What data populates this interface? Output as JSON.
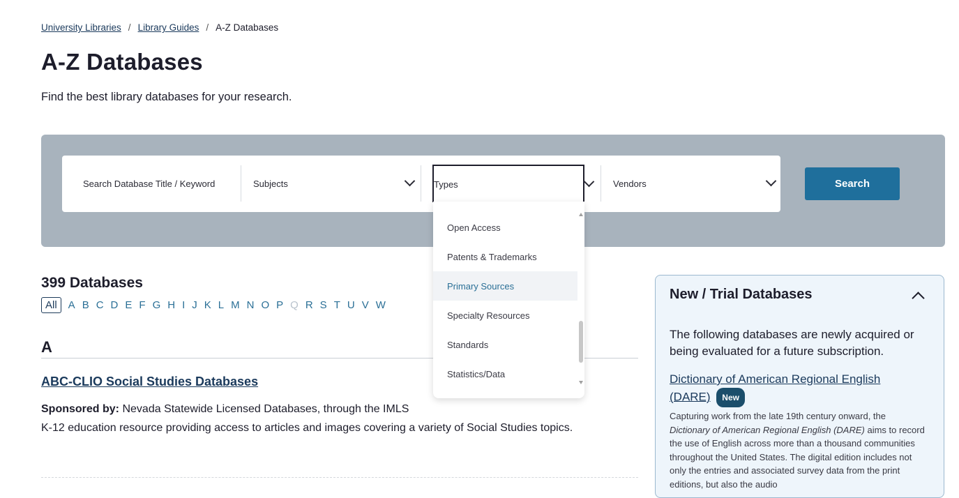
{
  "breadcrumb": {
    "items": [
      "University Libraries",
      "Library Guides"
    ],
    "current": "A-Z Databases",
    "separator": "/"
  },
  "page": {
    "title": "A-Z Databases",
    "subtitle": "Find the best library databases for your research."
  },
  "search": {
    "placeholder": "Search Database Title / Keyword",
    "subjects_label": "Subjects",
    "types_label": "Types",
    "vendors_label": "Vendors",
    "button_label": "Search"
  },
  "types_dropdown": {
    "items": [
      "Open Access",
      "Patents & Trademarks",
      "Primary Sources",
      "Specialty Resources",
      "Standards",
      "Statistics/Data"
    ],
    "highlighted": "Primary Sources"
  },
  "results": {
    "count_label": "399 Databases",
    "letters": [
      "All",
      "A",
      "B",
      "C",
      "D",
      "E",
      "F",
      "G",
      "H",
      "I",
      "J",
      "K",
      "L",
      "M",
      "N",
      "O",
      "P",
      "Q",
      "R",
      "S",
      "T",
      "U",
      "V",
      "W"
    ],
    "disabled_letters": [
      "Q"
    ]
  },
  "section": {
    "letter": "A",
    "databases": [
      {
        "title": "ABC-CLIO Social Studies Databases",
        "sponsor_label": "Sponsored by:",
        "sponsor": "Nevada Statewide Licensed Databases, through the IMLS",
        "description": "K-12 education resource providing access to articles and images covering a variety of Social Studies topics."
      }
    ]
  },
  "trial": {
    "heading": "New / Trial Databases",
    "intro": "The following databases are newly acquired or being evaluated for a future subscription.",
    "link_title": "Dictionary of American Regional English (DARE)",
    "badge": "New",
    "desc_before": "Capturing work from the late 19th century onward, the ",
    "desc_italic": "Dictionary of American Regional English (DARE)",
    "desc_after": " aims to record the use of English across more than a thousand communities throughout the United States. The digital edition includes not only the entries and associated survey data from the print editions, but also the audio"
  },
  "colors": {
    "primary": "#1f6f9c",
    "link": "#1b3a5c",
    "panel": "#a8b3bd",
    "trial_bg": "#eef5fb"
  }
}
